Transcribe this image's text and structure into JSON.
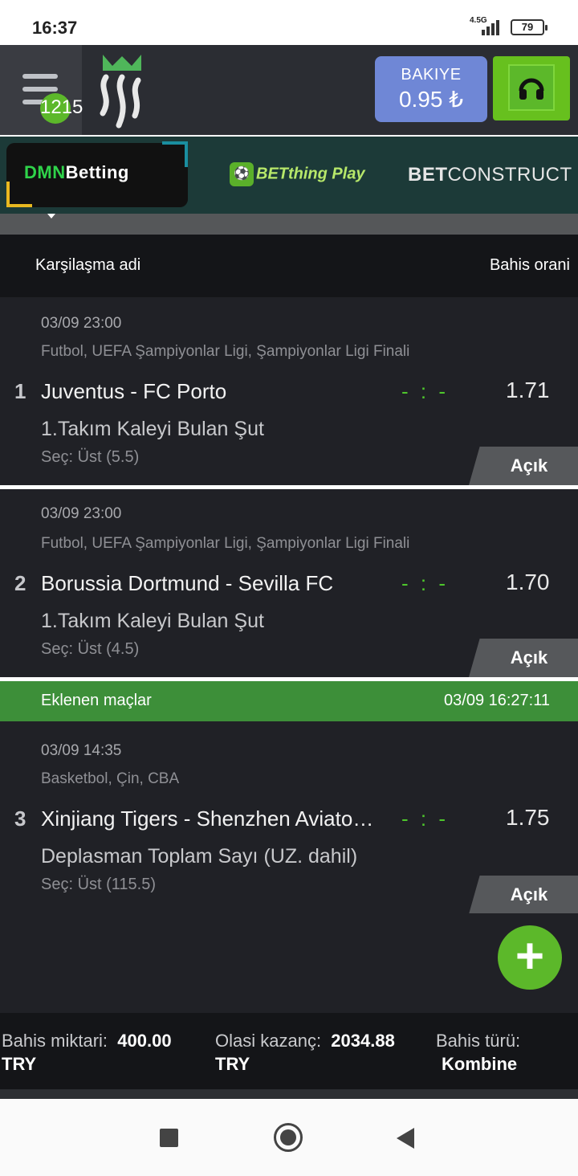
{
  "status_bar": {
    "time": "16:37",
    "network": "4.5G",
    "battery": "79"
  },
  "header": {
    "menu_badge": "1215",
    "balance_label": "BAKIYE",
    "balance_value": "0.95 ₺",
    "support_icon": "headphones-icon",
    "accent_color": "#5cb82a"
  },
  "providers": [
    {
      "name_prefix": "DMN",
      "name_rest": "Betting",
      "active": true
    },
    {
      "name": "BETthing Play",
      "active": false
    },
    {
      "name_bold": "BET",
      "name_rest": "CONSTRUCT",
      "active": false
    }
  ],
  "table": {
    "col_match": "Karşilaşma adi",
    "col_odds": "Bahis orani"
  },
  "bets": [
    {
      "index": "1",
      "date": "03/09 23:00",
      "league": "Futbol,  UEFA Şampiyonlar Ligi,  Şampiyonlar Ligi Finali",
      "match": "Juventus - FC Porto",
      "score": "- : -",
      "odd": "1.71",
      "market": "1.Takım Kaleyi Bulan Şut",
      "pick": "Seç: Üst (5.5)",
      "status": "Açık"
    },
    {
      "index": "2",
      "date": "03/09 23:00",
      "league": "Futbol,  UEFA Şampiyonlar Ligi,  Şampiyonlar Ligi Finali",
      "match": "Borussia Dortmund - Sevilla FC",
      "score": "- : -",
      "odd": "1.70",
      "market": "1.Takım Kaleyi Bulan Şut",
      "pick": "Seç: Üst (4.5)",
      "status": "Açık"
    },
    {
      "index": "3",
      "date": "03/09 14:35",
      "league": "Basketbol,  Çin,  CBA",
      "match": "Xinjiang Tigers - Shenzhen Aviato…",
      "score": "- : -",
      "odd": "1.75",
      "market": "Deplasman Toplam Sayı (UZ. dahil)",
      "pick": "Seç: Üst (115.5)",
      "status": "Açık"
    }
  ],
  "added_bar": {
    "label": "Eklenen maçlar",
    "timestamp": "03/09 16:27:11"
  },
  "summary": {
    "stake_label": "Bahis miktari:",
    "stake_value": "400.00",
    "stake_currency": "TRY",
    "win_label": "Olasi kazanç:",
    "win_value": "2034.88",
    "win_currency": "TRY",
    "type_label": "Bahis türü:",
    "type_value": "Kombine"
  },
  "fab_label": "+"
}
